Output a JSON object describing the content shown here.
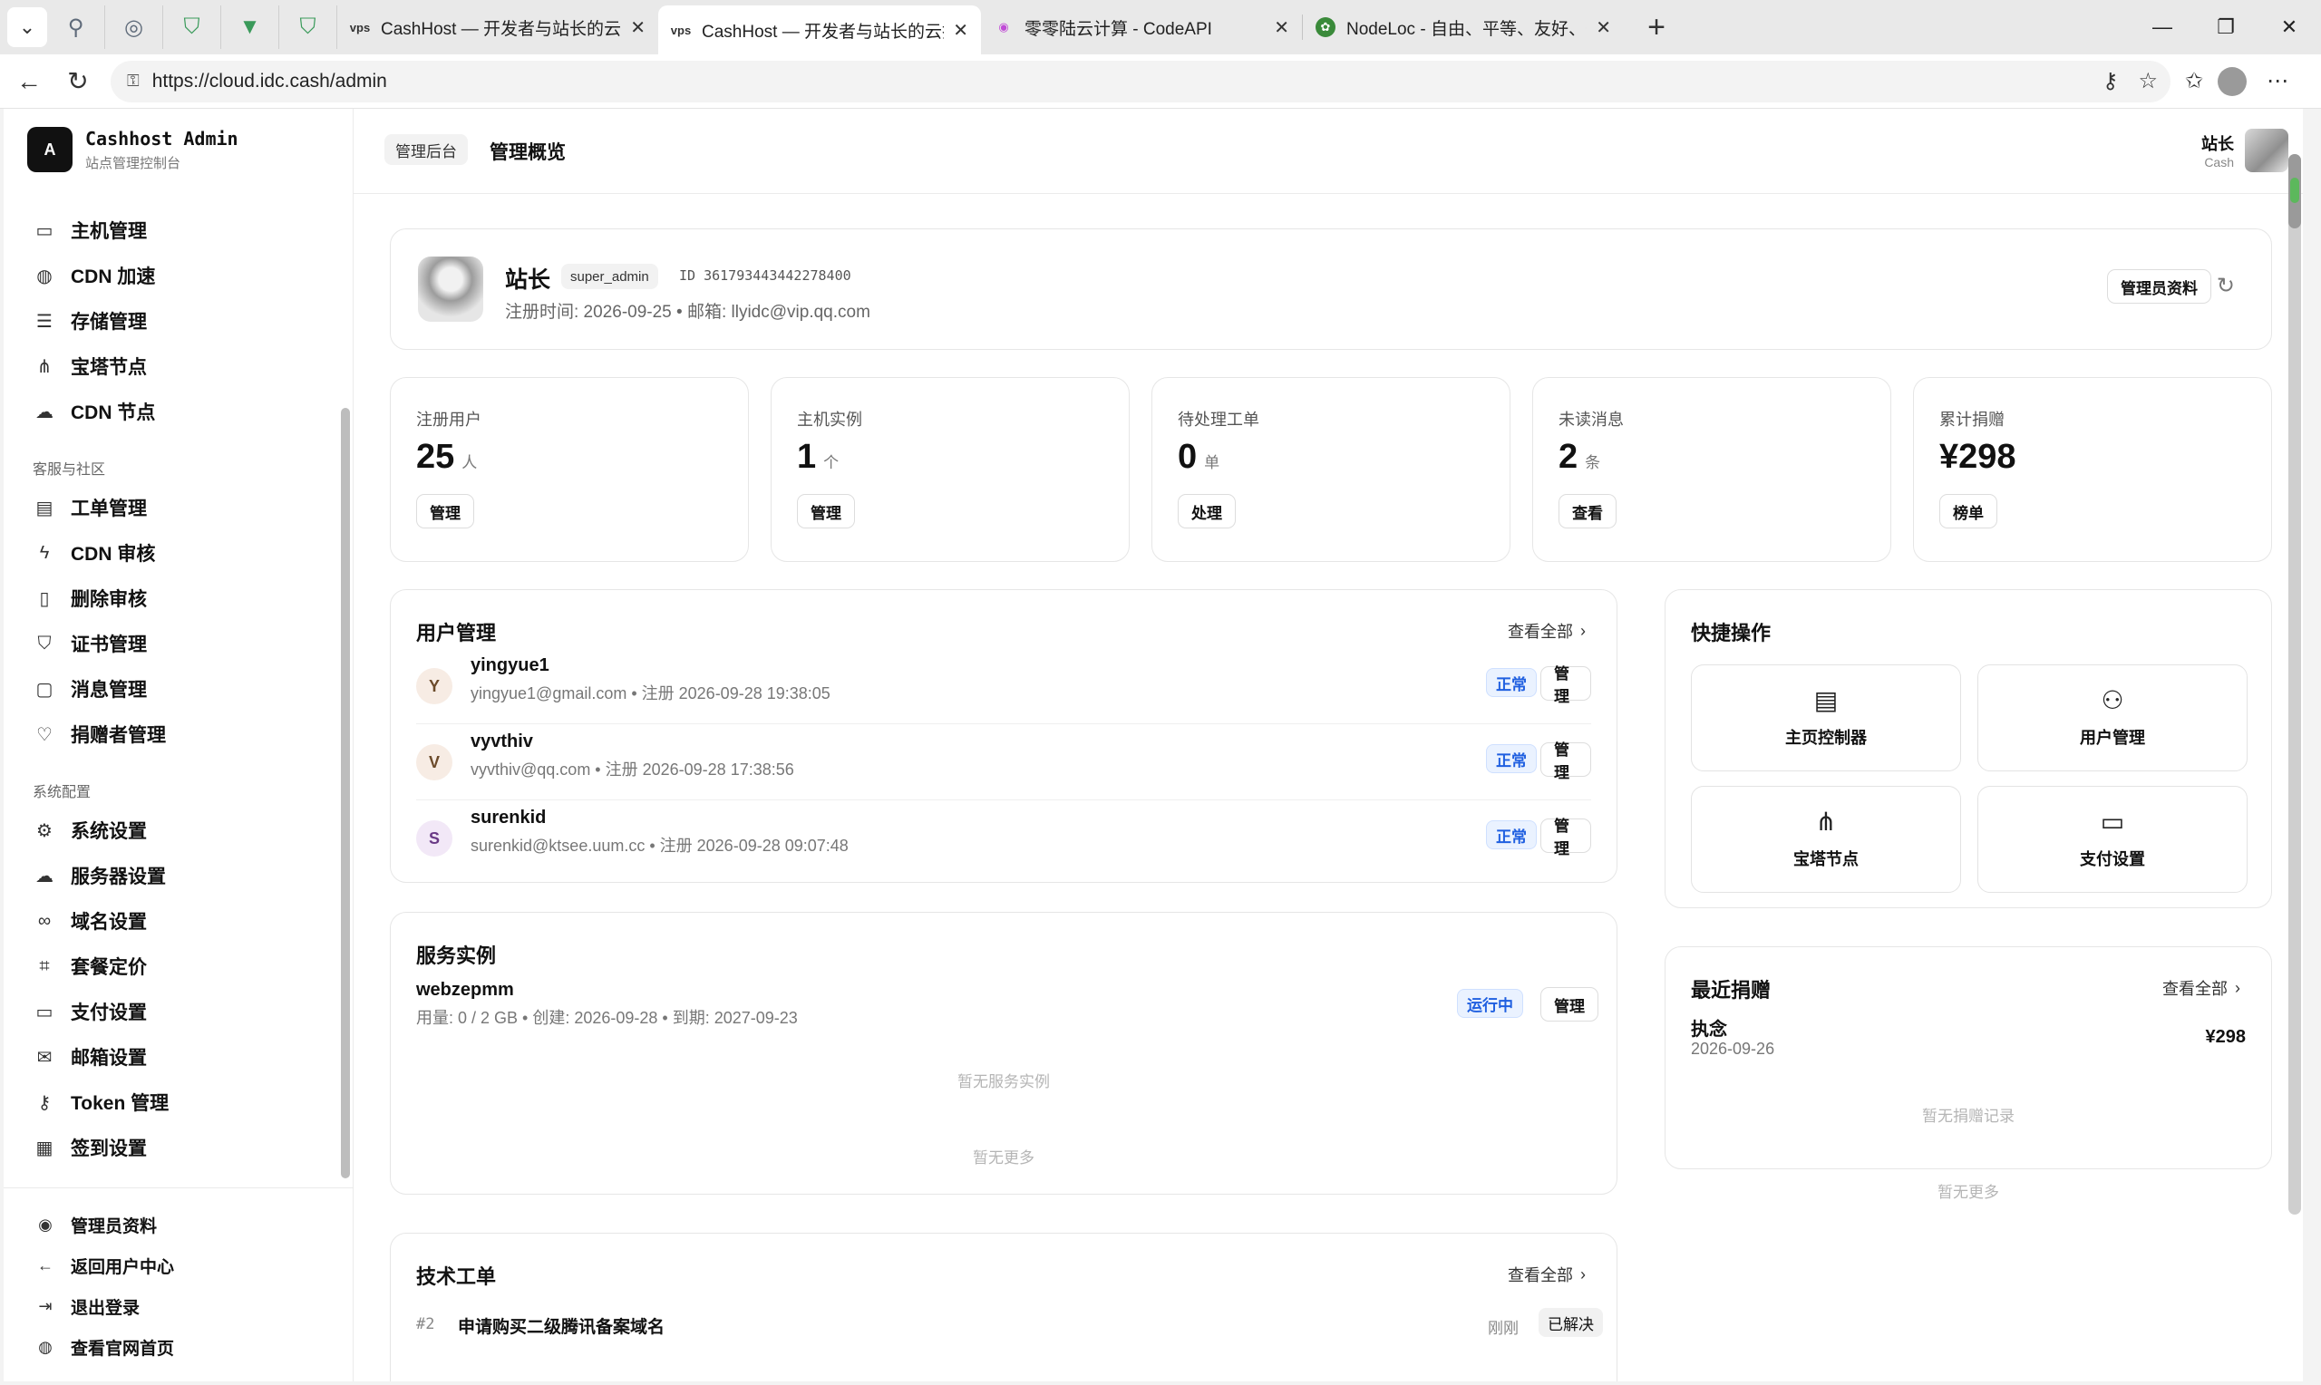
{
  "browser": {
    "tabs": [
      {
        "label": "CashHost — 开发者与站长的云托管",
        "favicon": "vps"
      },
      {
        "label": "CashHost — 开发者与站长的云托管",
        "favicon": "vps"
      },
      {
        "label": "零零陆云计算 - CodeAPI",
        "favicon": "swirl"
      },
      {
        "label": "NodeLoc - 自由、平等、友好、开放",
        "favicon": "leaf"
      }
    ],
    "url": "https://cloud.idc.cash/admin"
  },
  "sidebar": {
    "brand_logo": "A",
    "brand_title": "Cashhost Admin",
    "brand_subtitle": "站点管理控制台",
    "group1": [
      {
        "label": "主机管理",
        "icon": "server-icon"
      },
      {
        "label": "CDN 加速",
        "icon": "globe-icon"
      },
      {
        "label": "存储管理",
        "icon": "database-icon"
      },
      {
        "label": "宝塔节点",
        "icon": "network-icon"
      },
      {
        "label": "CDN 节点",
        "icon": "cloud-icon"
      }
    ],
    "group2_title": "客服与社区",
    "group2": [
      {
        "label": "工单管理",
        "icon": "document-icon"
      },
      {
        "label": "CDN 审核",
        "icon": "lightning-icon"
      },
      {
        "label": "删除审核",
        "icon": "trash-icon"
      },
      {
        "label": "证书管理",
        "icon": "shield-icon"
      },
      {
        "label": "消息管理",
        "icon": "message-icon"
      },
      {
        "label": "捐赠者管理",
        "icon": "heart-icon"
      }
    ],
    "group3_title": "系统配置",
    "group3": [
      {
        "label": "系统设置",
        "icon": "gear-icon"
      },
      {
        "label": "服务器设置",
        "icon": "cloud-icon"
      },
      {
        "label": "域名设置",
        "icon": "link-icon"
      },
      {
        "label": "套餐定价",
        "icon": "tag-icon"
      },
      {
        "label": "支付设置",
        "icon": "card-icon"
      },
      {
        "label": "邮箱设置",
        "icon": "mail-icon"
      },
      {
        "label": "Token 管理",
        "icon": "key-icon"
      },
      {
        "label": "签到设置",
        "icon": "calendar-icon"
      }
    ],
    "footer": [
      {
        "label": "管理员资料",
        "icon": "user-circle-icon"
      },
      {
        "label": "返回用户中心",
        "icon": "arrow-left-icon"
      },
      {
        "label": "退出登录",
        "icon": "logout-icon"
      },
      {
        "label": "查看官网首页",
        "icon": "globe-icon"
      }
    ]
  },
  "header": {
    "breadcrumb": "管理后台",
    "title": "管理概览",
    "user_name": "站长",
    "user_sub": "Cash"
  },
  "profile": {
    "name": "站长",
    "role": "super_admin",
    "id": "ID 3617934434422784​00",
    "meta": "注册时间: 2026-09-25 • 邮箱: llyidc@vip.qq.com",
    "button": "管理员资料"
  },
  "stats": [
    {
      "label": "注册用户",
      "value": "25",
      "unit": "人",
      "button": "管理"
    },
    {
      "label": "主机实例",
      "value": "1",
      "unit": "个",
      "button": "管理"
    },
    {
      "label": "待处理工单",
      "value": "0",
      "unit": "单",
      "button": "处理"
    },
    {
      "label": "未读消息",
      "value": "2",
      "unit": "条",
      "button": "查看"
    },
    {
      "label": "累计捐赠",
      "value": "¥298",
      "unit": "",
      "button": "榜单"
    }
  ],
  "users": {
    "title": "用户管理",
    "link": "查看全部",
    "rows": [
      {
        "initial": "Y",
        "name": "yingyue1",
        "meta": "yingyue1@gmail.com • 注册 2026-09-28 19:38:05",
        "status": "正常",
        "button": "管理"
      },
      {
        "initial": "V",
        "name": "vyvthiv",
        "meta": "vyvthiv@qq.com • 注册 2026-09-28 17:38:56",
        "status": "正常",
        "button": "管理"
      },
      {
        "initial": "S",
        "name": "surenkid",
        "meta": "surenkid@ktsee.uum.cc • 注册 2026-09-28 09:07:48",
        "status": "正常",
        "button": "管理"
      }
    ]
  },
  "quick": {
    "title": "快捷操作",
    "items": [
      {
        "label": "主页控制器",
        "icon": "layout-icon"
      },
      {
        "label": "用户管理",
        "icon": "users-icon"
      },
      {
        "label": "宝塔节点",
        "icon": "network-icon"
      },
      {
        "label": "支付设置",
        "icon": "card-icon"
      }
    ]
  },
  "instances": {
    "title": "服务实例",
    "name": "webzepmm",
    "meta": "用量: 0 / 2 GB • 创建: 2026-09-28 • 到期: 2027-09-23",
    "status": "运行中",
    "button": "管理",
    "empty": "暂无服务实例",
    "more": "暂无更多"
  },
  "donations": {
    "title": "最近捐赠",
    "link": "查看全部",
    "name": "执念",
    "date": "2026-09-26",
    "amount": "¥298",
    "empty": "暂无捐赠记录",
    "more": "暂无更多"
  },
  "tickets": {
    "title": "技术工单",
    "link": "查看全部",
    "number": "#2",
    "subject": "申请购买二级腾讯备案域名",
    "time": "刚刚",
    "status": "已解决"
  },
  "colors": {
    "accent_blue": "#1f5fe0",
    "status_bg": "#eaf2ff",
    "brand_dark": "#111111"
  }
}
